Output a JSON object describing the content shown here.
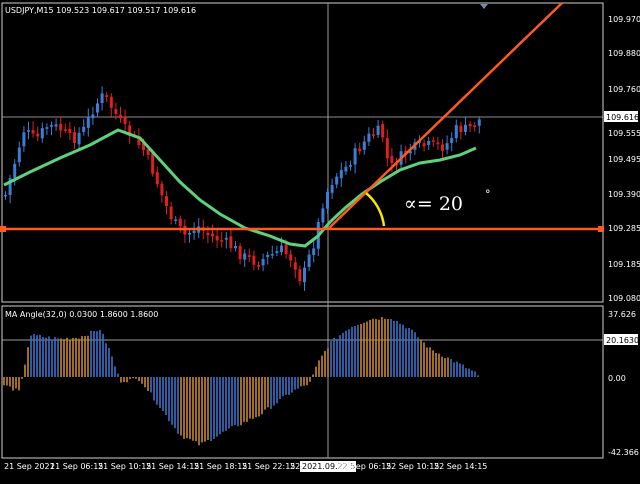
{
  "main_chart": {
    "title": "USDJPY,M15  109.523 109.617 109.517 109.616",
    "price_axis": [
      "109.970",
      "109.880",
      "109.760",
      "109.616",
      "109.555",
      "109.495",
      "109.390",
      "109.285",
      "109.185",
      "109.080"
    ],
    "current_price": "109.616",
    "horizontal_line_price": 109.29,
    "angle_label": "∝= 20",
    "degree_symbol": "°",
    "colors": {
      "bull_candle": "#3a7fd5",
      "bear_candle": "#e02020",
      "moving_average": "#5ed17b",
      "trend_line": "#ff5a1f",
      "horizontal_line": "#ff5a1f",
      "angle_arc": "#ffe400"
    }
  },
  "sub_chart": {
    "title": "MA Angle(32,0) 0.0300 1.8600 1.8600",
    "axis": [
      "37.626",
      "20.1630",
      "0.00",
      "-42.366"
    ],
    "level": "20.1630",
    "colors": {
      "positive_bar": "#c88a2c",
      "negative_bar": "#3b72c9"
    }
  },
  "time_axis": [
    "21 Sep 2021",
    "21 Sep 06:15",
    "21 Sep 10:15",
    "21 Sep 14:15",
    "21 Sep 18:15",
    "21 Sep 22:15",
    "22",
    "22 Sep 06:15",
    "22 Sep 10:15",
    "22 Sep 14:15"
  ],
  "crosshair_time": "2021.09.22 5:15"
}
